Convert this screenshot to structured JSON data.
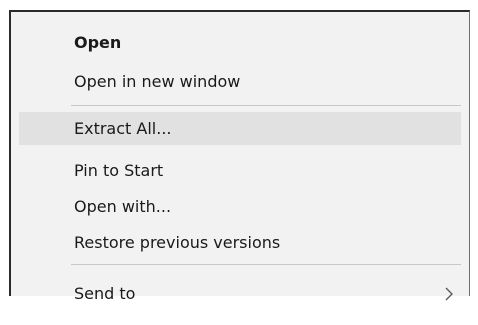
{
  "context_menu": {
    "items": [
      {
        "label": "Open"
      },
      {
        "label": "Open in new window"
      },
      {
        "label": "Extract All..."
      },
      {
        "label": "Pin to Start"
      },
      {
        "label": "Open with..."
      },
      {
        "label": "Restore previous versions"
      },
      {
        "label": "Send to"
      }
    ],
    "hover_color": "#e1e1e1",
    "background_color": "#f2f2f2",
    "submenu_icon": "chevron-right-icon"
  }
}
